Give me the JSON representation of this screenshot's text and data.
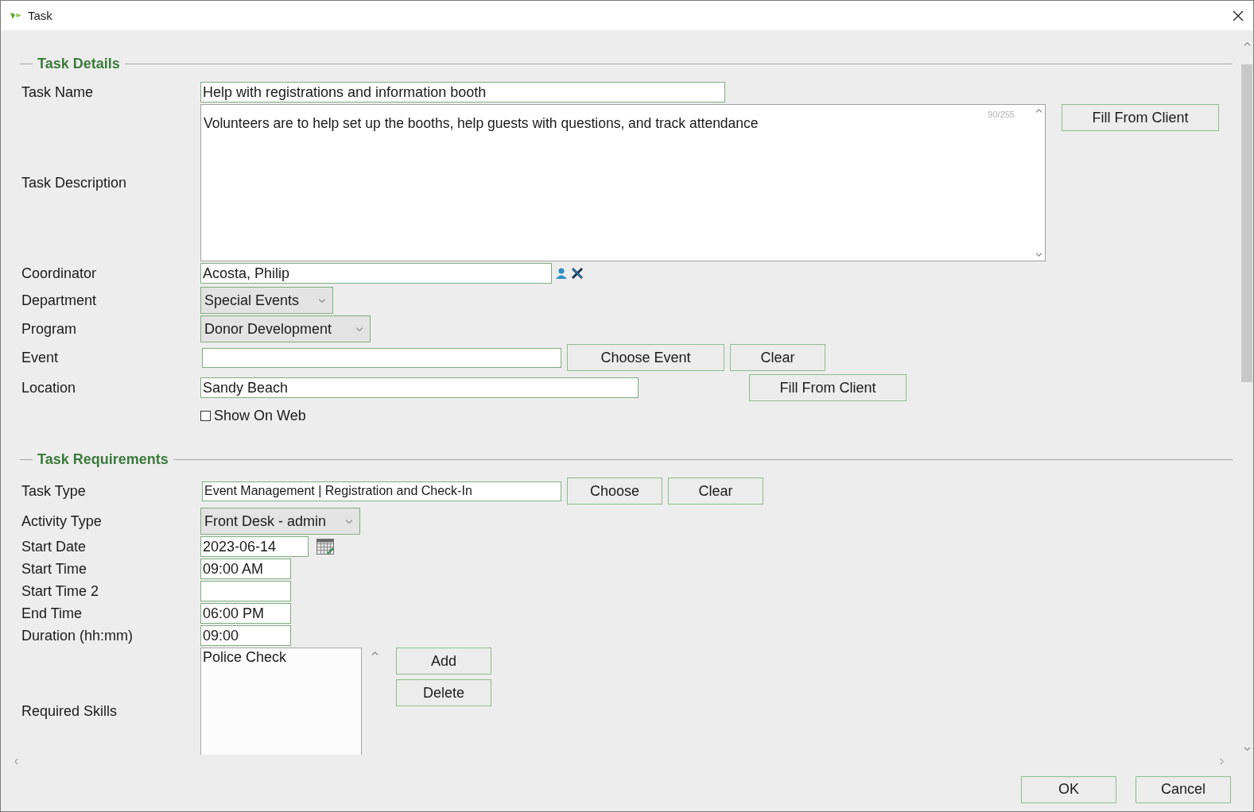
{
  "window": {
    "title": "Task"
  },
  "sections": [
    {
      "title": "Task Details",
      "rows": [
        {
          "kind": "text",
          "label": "Task Name",
          "value": "Help with registrations and information booth"
        },
        {
          "kind": "textarea",
          "label": "Task Description",
          "value": "Volunteers are to help set up the booths, help guests with questions, and track attendance",
          "counter": "90/255",
          "buttons": [
            "Fill From Client"
          ]
        },
        {
          "kind": "lookup",
          "label": "Coordinator",
          "value": "Acosta, Philip"
        },
        {
          "kind": "select",
          "label": "Department",
          "value": "Special Events"
        },
        {
          "kind": "select",
          "label": "Program",
          "value": "Donor Development"
        },
        {
          "kind": "chooser",
          "label": "Event",
          "buttons": [
            "Choose Event",
            "Clear"
          ]
        },
        {
          "kind": "text_button",
          "label": "Location",
          "value": "Sandy Beach",
          "buttons": [
            "Fill From Client"
          ]
        },
        {
          "kind": "checkbox",
          "label": "Show On Web",
          "checked": false
        }
      ]
    },
    {
      "title": "Task Requirements",
      "rows": [
        {
          "kind": "chooser",
          "label": "Task Type",
          "value": "Event Management | Registration and Check-In",
          "buttons": [
            "Choose",
            "Clear"
          ]
        },
        {
          "kind": "select",
          "label": "Activity Type",
          "value": "Front Desk - admin"
        },
        {
          "kind": "date",
          "label": "Start Date",
          "value": "2023-06-14"
        },
        {
          "kind": "short",
          "label": "Start Time",
          "value": "09:00 AM"
        },
        {
          "kind": "short",
          "label": "Start Time 2"
        },
        {
          "kind": "short",
          "label": "End Time",
          "value": "06:00 PM"
        },
        {
          "kind": "short",
          "label": "Duration (hh:mm)",
          "value": "09:00"
        },
        {
          "kind": "list",
          "label": "Required Skills",
          "items": [
            "Police Check"
          ],
          "buttons": [
            "Add",
            "Delete"
          ]
        }
      ]
    }
  ],
  "buttons": [
    "OK",
    "Cancel"
  ]
}
